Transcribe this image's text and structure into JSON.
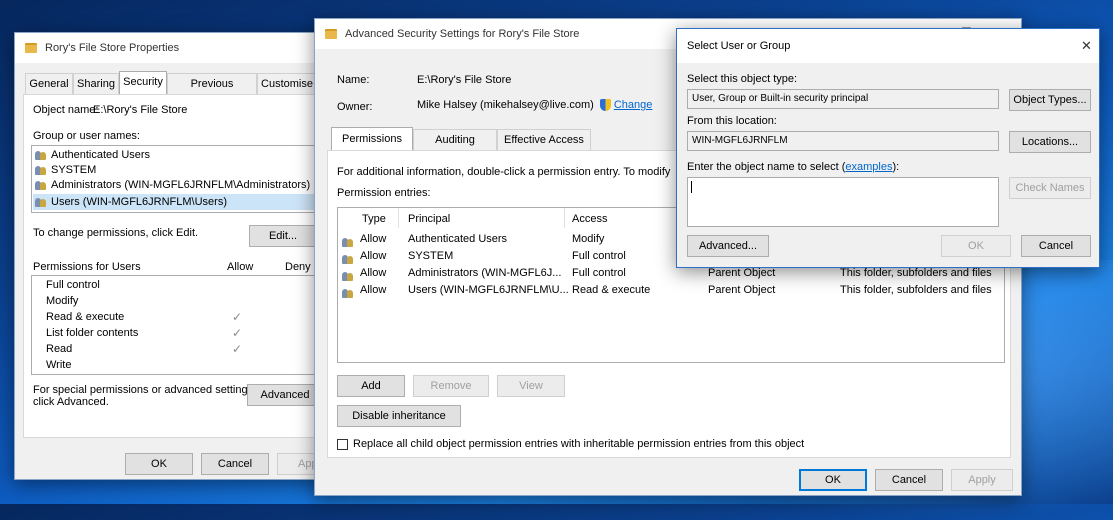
{
  "properties": {
    "title": "Rory's File Store Properties",
    "tabs": [
      "General",
      "Sharing",
      "Security",
      "Previous Versions",
      "Customise"
    ],
    "object_name_label": "Object name:",
    "object_name_value": "E:\\Rory's File Store",
    "group_label": "Group or user names:",
    "groups": [
      "Authenticated Users",
      "SYSTEM",
      "Administrators (WIN-MGFL6JRNFLM\\Administrators)",
      "Users (WIN-MGFL6JRNFLM\\Users)"
    ],
    "change_perm_text": "To change permissions, click Edit.",
    "edit_button": "Edit...",
    "perm_for": "Permissions for Users",
    "allow_col": "Allow",
    "deny_col": "Deny",
    "permissions": [
      "Full control",
      "Modify",
      "Read & execute",
      "List folder contents",
      "Read",
      "Write"
    ],
    "special_text_1": "For special permissions or advanced settings,",
    "special_text_2": "click Advanced.",
    "advanced_button": "Advanced",
    "ok_button": "OK",
    "cancel_button": "Cancel",
    "apply_button": "Appl"
  },
  "advanced": {
    "title": "Advanced Security Settings for Rory's File Store",
    "name_label": "Name:",
    "name_value": "E:\\Rory's File Store",
    "owner_label": "Owner:",
    "owner_value": "Mike Halsey (mikehalsey@live.com)",
    "change_link": "Change",
    "tabs": [
      "Permissions",
      "Auditing",
      "Effective Access"
    ],
    "info_text": "For additional information, double-click a permission entry. To modify",
    "entries_label": "Permission entries:",
    "columns": [
      "Type",
      "Principal",
      "Access"
    ],
    "entries": [
      {
        "type": "Allow",
        "principal": "Authenticated Users",
        "access": "Modify",
        "inherited": "",
        "applies": ""
      },
      {
        "type": "Allow",
        "principal": "SYSTEM",
        "access": "Full control",
        "inherited": "",
        "applies": ""
      },
      {
        "type": "Allow",
        "principal": "Administrators (WIN-MGFL6J...",
        "access": "Full control",
        "inherited": "Parent Object",
        "applies": "This folder, subfolders and files"
      },
      {
        "type": "Allow",
        "principal": "Users (WIN-MGFL6JRNFLM\\U...",
        "access": "Read & execute",
        "inherited": "Parent Object",
        "applies": "This folder, subfolders and files"
      }
    ],
    "add_button": "Add",
    "remove_button": "Remove",
    "view_button": "View",
    "disable_button": "Disable inheritance",
    "replace_text": "Replace all child object permission entries with inheritable permission entries from this object",
    "ok_button": "OK",
    "cancel_button": "Cancel",
    "apply_button": "Apply"
  },
  "select": {
    "title": "Select User or Group",
    "close": "✕",
    "object_type_label": "Select this object type:",
    "object_type_value": "User, Group or Built-in security principal",
    "object_types_button": "Object Types...",
    "location_label": "From this location:",
    "location_value": "WIN-MGFL6JRNFLM",
    "locations_button": "Locations...",
    "enter_label": "Enter the object name to select (",
    "examples_link": "examples",
    "enter_label_end": "):",
    "check_names_button": "Check Names",
    "advanced_button": "Advanced...",
    "ok_button": "OK",
    "cancel_button": "Cancel"
  }
}
